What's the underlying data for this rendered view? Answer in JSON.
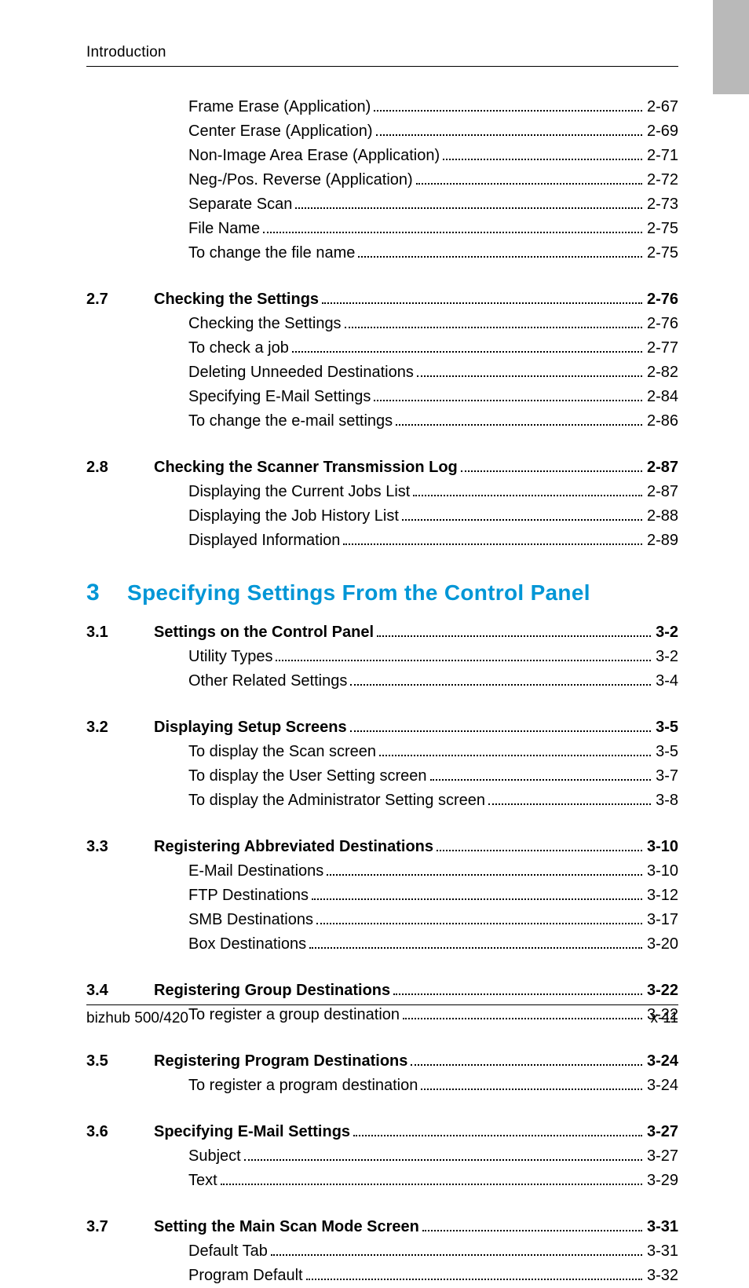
{
  "header": {
    "running_title": "Introduction"
  },
  "pre_sections": [
    {
      "items": [
        {
          "title": "Frame Erase (Application)",
          "page": "2-67"
        },
        {
          "title": "Center Erase (Application)",
          "page": "2-69"
        },
        {
          "title": "Non-Image Area Erase (Application)",
          "page": "2-71"
        },
        {
          "title": "Neg-/Pos. Reverse (Application)",
          "page": "2-72"
        },
        {
          "title": "Separate Scan",
          "page": "2-73"
        },
        {
          "title": "File Name",
          "page": "2-75"
        },
        {
          "title": "To change the file name",
          "page": "2-75"
        }
      ]
    },
    {
      "num": "2.7",
      "title": "Checking the Settings",
      "page": "2-76",
      "items": [
        {
          "title": "Checking the Settings",
          "page": "2-76"
        },
        {
          "title": "To check a job",
          "page": "2-77"
        },
        {
          "title": "Deleting Unneeded Destinations",
          "page": "2-82"
        },
        {
          "title": "Specifying E-Mail Settings",
          "page": "2-84"
        },
        {
          "title": "To change the e-mail settings",
          "page": "2-86"
        }
      ]
    },
    {
      "num": "2.8",
      "title": "Checking the Scanner Transmission Log",
      "page": "2-87",
      "items": [
        {
          "title": "Displaying the Current Jobs List",
          "page": "2-87"
        },
        {
          "title": "Displaying the Job History List",
          "page": "2-88"
        },
        {
          "title": "Displayed Information",
          "page": "2-89"
        }
      ]
    }
  ],
  "chapter": {
    "num": "3",
    "title": "Specifying Settings From the Control Panel"
  },
  "sections": [
    {
      "num": "3.1",
      "title": "Settings on the Control Panel",
      "page": "3-2",
      "items": [
        {
          "title": "Utility Types",
          "page": "3-2"
        },
        {
          "title": "Other Related Settings",
          "page": "3-4"
        }
      ]
    },
    {
      "num": "3.2",
      "title": "Displaying Setup Screens",
      "page": "3-5",
      "items": [
        {
          "title": "To display the Scan screen",
          "page": "3-5"
        },
        {
          "title": "To display the User Setting screen",
          "page": "3-7"
        },
        {
          "title": "To display the Administrator Setting screen",
          "page": "3-8"
        }
      ]
    },
    {
      "num": "3.3",
      "title": "Registering Abbreviated Destinations",
      "page": "3-10",
      "items": [
        {
          "title": "E-Mail Destinations",
          "page": "3-10"
        },
        {
          "title": "FTP Destinations",
          "page": "3-12"
        },
        {
          "title": "SMB Destinations",
          "page": "3-17"
        },
        {
          "title": "Box Destinations",
          "page": "3-20"
        }
      ]
    },
    {
      "num": "3.4",
      "title": "Registering Group Destinations",
      "page": "3-22",
      "items": [
        {
          "title": "To register a group destination",
          "page": "3-22"
        }
      ]
    },
    {
      "num": "3.5",
      "title": "Registering Program Destinations",
      "page": "3-24",
      "items": [
        {
          "title": "To register a program destination",
          "page": "3-24"
        }
      ]
    },
    {
      "num": "3.6",
      "title": "Specifying E-Mail Settings",
      "page": "3-27",
      "items": [
        {
          "title": "Subject",
          "page": "3-27"
        },
        {
          "title": "Text",
          "page": "3-29"
        }
      ]
    },
    {
      "num": "3.7",
      "title": "Setting the Main Scan Mode Screen",
      "page": "3-31",
      "items": [
        {
          "title": "Default Tab",
          "page": "3-31"
        },
        {
          "title": "Program Default",
          "page": "3-32"
        }
      ]
    }
  ],
  "footer": {
    "left": "bizhub 500/420",
    "right": "x-11"
  }
}
